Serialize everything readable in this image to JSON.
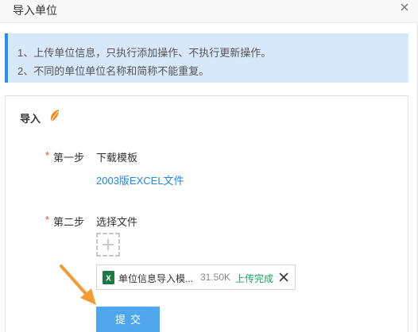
{
  "header": {
    "title": "导入单位"
  },
  "notice": {
    "lines": [
      "1、上传单位信息，只执行添加操作、不执行更新操作。",
      "2、不同的单位单位名称和简称不能重复。"
    ]
  },
  "panel": {
    "title": "导入",
    "title_icon": "leaf-icon",
    "step1": {
      "required_mark": "*",
      "label": "第一步",
      "title": "下载模板",
      "link": "2003版EXCEL文件"
    },
    "step2": {
      "required_mark": "*",
      "label": "第二步",
      "title": "选择文件",
      "add_icon": "plus-icon",
      "file": {
        "icon": "excel-icon",
        "name": "单位信息导入模...",
        "size": "31.50K",
        "status": "上传完成",
        "remove_icon": "close-icon"
      }
    },
    "submit_label": "提交"
  },
  "colors": {
    "accent": "#2d8cf0",
    "notice_bg": "#d8e8fb",
    "link": "#1e88e5",
    "required": "#e74c3c",
    "success": "#19a35b",
    "submit_bg": "#4ea6ed",
    "arrow": "#f39c34"
  }
}
